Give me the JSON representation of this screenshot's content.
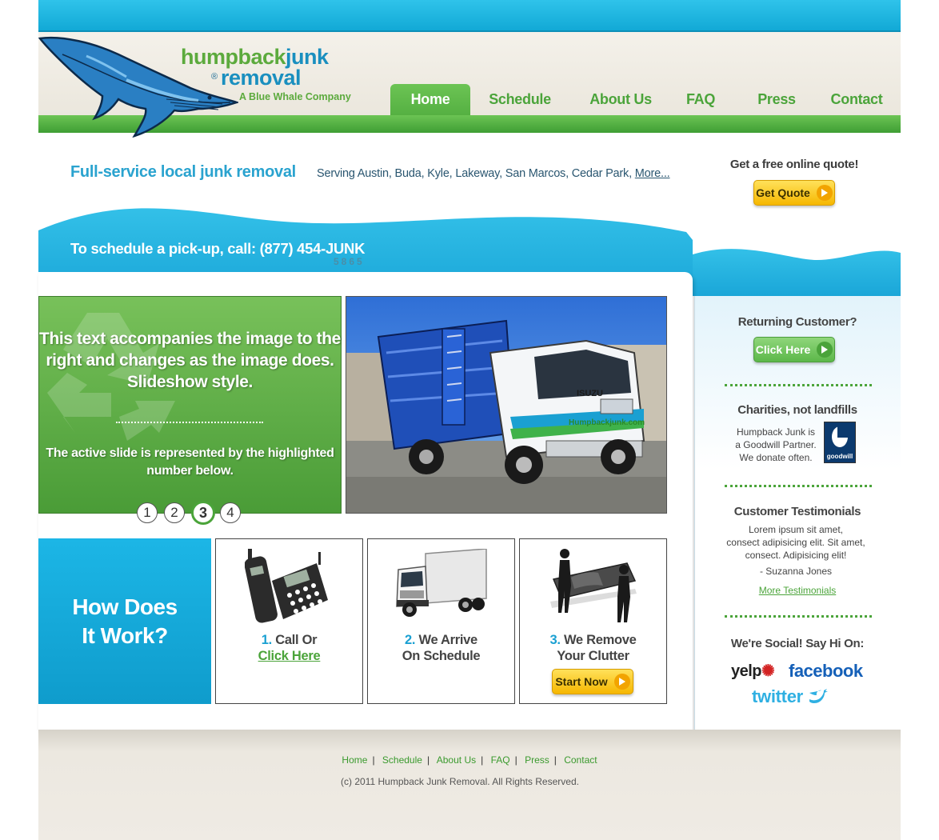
{
  "brand": {
    "name_part1": "humpback",
    "name_part2": "junk",
    "registered": "®",
    "name_line2": "removal",
    "tagline": "A Blue Whale Company"
  },
  "nav": {
    "items": [
      {
        "label": "Home",
        "active": true
      },
      {
        "label": "Schedule"
      },
      {
        "label": "About Us"
      },
      {
        "label": "FAQ"
      },
      {
        "label": "Press"
      },
      {
        "label": "Contact"
      }
    ]
  },
  "intro": {
    "headline": "Full-service local junk removal",
    "serving": "Serving Austin, Buda, Kyle, Lakeway, San Marcos, Cedar Park,",
    "more_link": "More...",
    "quote_prompt": "Get a free online quote!",
    "quote_button": "Get Quote"
  },
  "call": {
    "text": "To schedule a pick-up, call: (877) 454-JUNK",
    "digits": "5865"
  },
  "slideshow": {
    "main_text": "This text accompanies the image to the right and changes as the image does. Slideshow style.",
    "sub_text": "The active slide is represented by the highlighted number below.",
    "numbers": [
      "1",
      "2",
      "3",
      "4"
    ],
    "active_index": 2,
    "truck_brand": "ISUZU",
    "truck_logo": "Humpbackjunk.com"
  },
  "how": {
    "title": "How Does It Work?",
    "steps": [
      {
        "num": "1.",
        "line1": "Call Or",
        "link": "Click Here",
        "icon": "phone-icon"
      },
      {
        "num": "2.",
        "line1": "We Arrive",
        "line2": "On Schedule",
        "icon": "truck-icon"
      },
      {
        "num": "3.",
        "line1": "We Remove",
        "line2": "Your Clutter",
        "button": "Start Now",
        "icon": "movers-icon"
      }
    ]
  },
  "sidebar": {
    "returning": "Returning Customer?",
    "click_here": "Click Here",
    "charities_head": "Charities, not landfills",
    "charities_text_1": "Humpback Junk is",
    "charities_text_2": "a Goodwill Partner.",
    "charities_text_3": "We donate often.",
    "goodwill_label": "goodwill",
    "testimonials_head": "Customer Testimonials",
    "testimonial_1": "Lorem ipsum sit amet,",
    "testimonial_2": "consect adipisicing elit. Sit amet,",
    "testimonial_3": "consect. Adipisicing elit!",
    "testimonial_author": "- Suzanna Jones",
    "more_testimonials": "More Testimonials",
    "social_head": "We're Social! Say Hi On:",
    "social": [
      "yelp",
      "facebook",
      "twitter"
    ]
  },
  "footer": {
    "links": [
      "Home",
      "Schedule",
      "About Us",
      "FAQ",
      "Press",
      "Contact"
    ],
    "copyright": "(c) 2011 Humpback Junk Removal. All Rights Reserved."
  },
  "colors": {
    "sky": "#12a9d6",
    "green": "#4ba43a",
    "yellow": "#f6b700"
  }
}
